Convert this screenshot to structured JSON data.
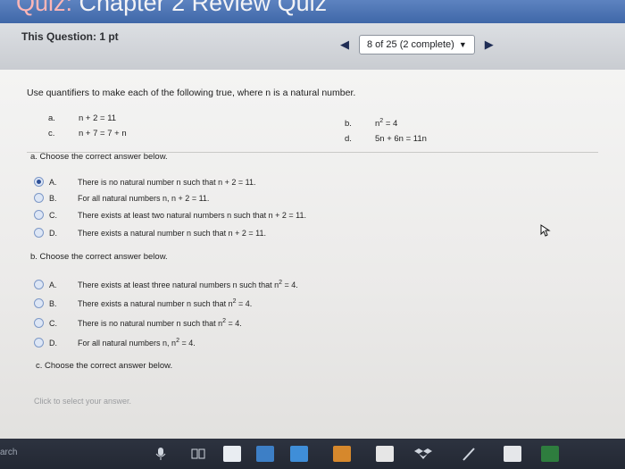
{
  "window": {
    "title_prefix": "Quiz:",
    "title_rest": " Chapter 2 Review Quiz"
  },
  "question_bar": {
    "label": "This Question: 1 pt",
    "progress": "8 of 25 (2 complete)"
  },
  "question": {
    "instruction": "Use quantifiers to make each of the following true, where n is a natural number.",
    "statements": [
      {
        "label": "a.",
        "expr": "n + 2 = 11"
      },
      {
        "label": "b.",
        "expr_base": "n",
        "expr_sup": "2",
        "expr_tail": " = 4"
      },
      {
        "label": "c.",
        "expr": "n + 7 = 7 + n"
      },
      {
        "label": "d.",
        "expr": "5n + 6n = 11n"
      }
    ]
  },
  "part_a": {
    "heading": "a. Choose the correct answer below.",
    "options": [
      {
        "letter": "A.",
        "text": "There is no natural number n such that n + 2 = 11.",
        "selected": true
      },
      {
        "letter": "B.",
        "text": "For all natural numbers n, n + 2 = 11.",
        "selected": false
      },
      {
        "letter": "C.",
        "text": "There exists at least two natural numbers n such that n + 2 = 11.",
        "selected": false
      },
      {
        "letter": "D.",
        "text": "There exists a natural number n such that n + 2 = 11.",
        "selected": false
      }
    ]
  },
  "part_b": {
    "heading": "b. Choose the correct answer below.",
    "options": [
      {
        "letter": "A.",
        "pre": "There exists at least three natural numbers n such that n",
        "sup": "2",
        "post": " = 4."
      },
      {
        "letter": "B.",
        "pre": "There exists a natural number n such that n",
        "sup": "2",
        "post": " = 4."
      },
      {
        "letter": "C.",
        "pre": "There is no natural number n such that n",
        "sup": "2",
        "post": " = 4."
      },
      {
        "letter": "D.",
        "pre": "For all natural numbers n, n",
        "sup": "2",
        "post": " = 4."
      }
    ]
  },
  "part_c": {
    "heading": "c. Choose the correct answer below.",
    "placeholder": "Click to select your answer."
  },
  "taskbar": {
    "search_text": "arch"
  },
  "colors": {
    "title_bar": "#4a70b0",
    "question_bar": "#d3d6da",
    "radio_selected": "#2d4f97",
    "taskbar": "#262b35"
  }
}
